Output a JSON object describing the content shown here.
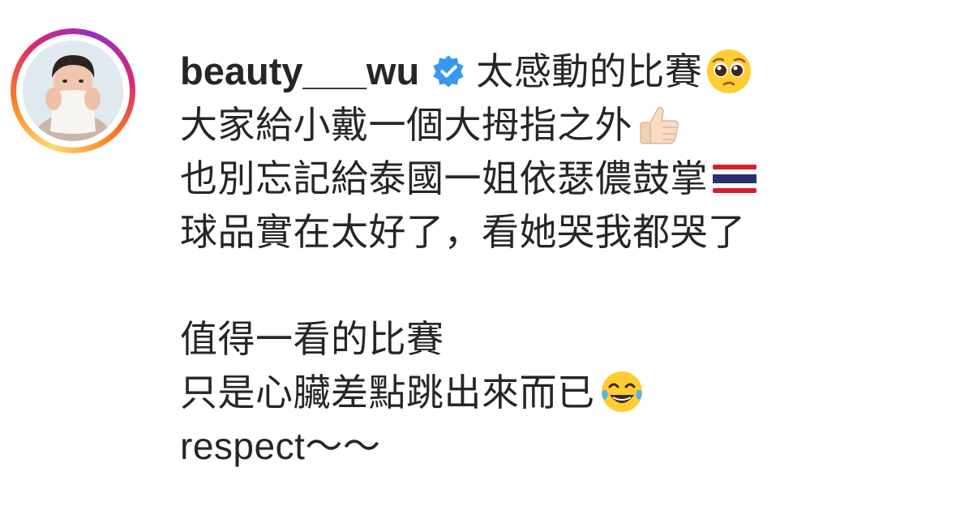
{
  "post": {
    "username": "beauty___wu",
    "caption_lines": [
      "太感動的比賽",
      "大家給小戴一個大拇指之外",
      "也別忘記給泰國一姐依瑟儂鼓掌",
      "球品實在太好了，看她哭我都哭了",
      "",
      "值得一看的比賽",
      "只是心臟差點跳出來而已",
      "respect～～"
    ],
    "icons": {
      "verified": "verified-badge-icon",
      "line1_emoji": "pleading-face-emoji",
      "line2_emoji": "thumbs-up-emoji",
      "line3_emoji": "thailand-flag-emoji",
      "line7_emoji": "tears-of-joy-emoji"
    },
    "colors": {
      "text": "#262626",
      "verified": "#3897f0",
      "ring_start": "#feda75",
      "ring_mid": "#d62976",
      "ring_end": "#962fbf"
    }
  }
}
